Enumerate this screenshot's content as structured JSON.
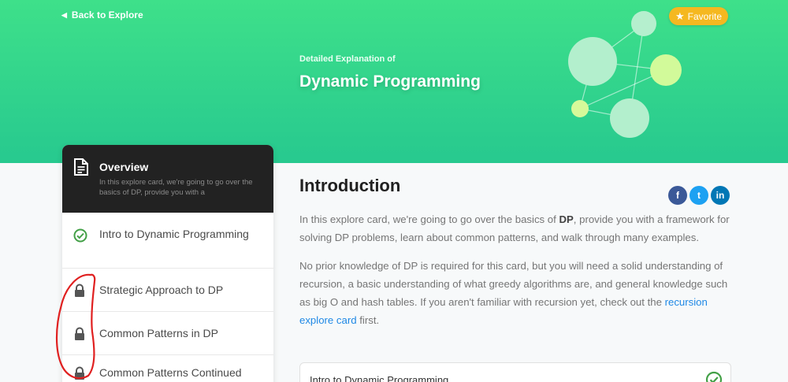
{
  "header": {
    "back_label": "Back to Explore",
    "favorite_label": "Favorite",
    "subtitle": "Detailed Explanation of",
    "title": "Dynamic Programming"
  },
  "sidebar": {
    "overview": {
      "title": "Overview",
      "description": "In this explore card, we're going to go over the basics of DP, provide you with a"
    },
    "items": [
      {
        "label": "Intro to Dynamic Programming",
        "icon": "check-circle-icon"
      },
      {
        "label": "Strategic Approach to DP",
        "icon": "lock-icon"
      },
      {
        "label": "Common Patterns in DP",
        "icon": "lock-icon"
      },
      {
        "label": "Common Patterns Continued",
        "icon": "lock-icon"
      }
    ]
  },
  "content": {
    "heading": "Introduction",
    "p1_before": "In this explore card, we're going to go over the basics of ",
    "p1_bold": "DP",
    "p1_after": ", provide you with a framework for solving DP problems, learn about common patterns, and walk through many examples.",
    "p2_before": "No prior knowledge of DP is required for this card, but you will need a solid understanding of recursion, a basic understanding of what greedy algorithms are, and general knowledge such as big O and hash tables. If you aren't familiar with recursion yet, check out the ",
    "p2_link": "recursion explore card",
    "p2_after": " first.",
    "next_card_label": "Intro to Dynamic Programming"
  },
  "social": {
    "facebook": "f",
    "twitter": "t",
    "linkedin": "in"
  },
  "colors": {
    "hero_gradient_top": "#3ee08a",
    "hero_gradient_bottom": "#27c98f",
    "favorite": "#f5b820",
    "check_green": "#43a047",
    "link_blue": "#1e88e5",
    "annotation_red": "#e02020"
  }
}
